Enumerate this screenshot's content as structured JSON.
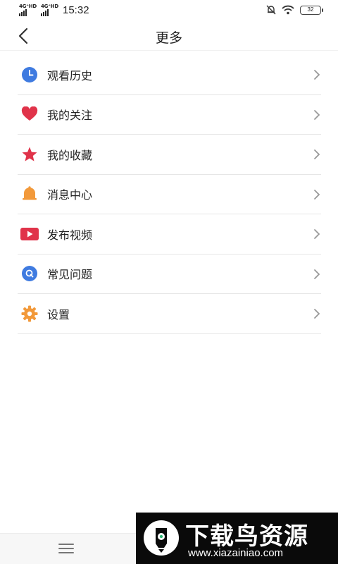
{
  "status_bar": {
    "network_1": "4G⁺HD",
    "network_2": "4G⁺HD",
    "time": "15:32",
    "battery": "32"
  },
  "header": {
    "title": "更多"
  },
  "menu": {
    "items": [
      {
        "label": "观看历史",
        "icon": "clock-icon",
        "color": "#3f7be0"
      },
      {
        "label": "我的关注",
        "icon": "heart-icon",
        "color": "#e0334a"
      },
      {
        "label": "我的收藏",
        "icon": "star-icon",
        "color": "#e0334a"
      },
      {
        "label": "消息中心",
        "icon": "bell-icon",
        "color": "#f2993a"
      },
      {
        "label": "发布视频",
        "icon": "video-play-icon",
        "color": "#e0334a"
      },
      {
        "label": "常见问题",
        "icon": "faq-icon",
        "color": "#3f7be0"
      },
      {
        "label": "设置",
        "icon": "gear-icon",
        "color": "#f2993a"
      }
    ]
  },
  "watermark": {
    "title": "下载鸟资源",
    "url": "www.xiazainiao.com"
  }
}
